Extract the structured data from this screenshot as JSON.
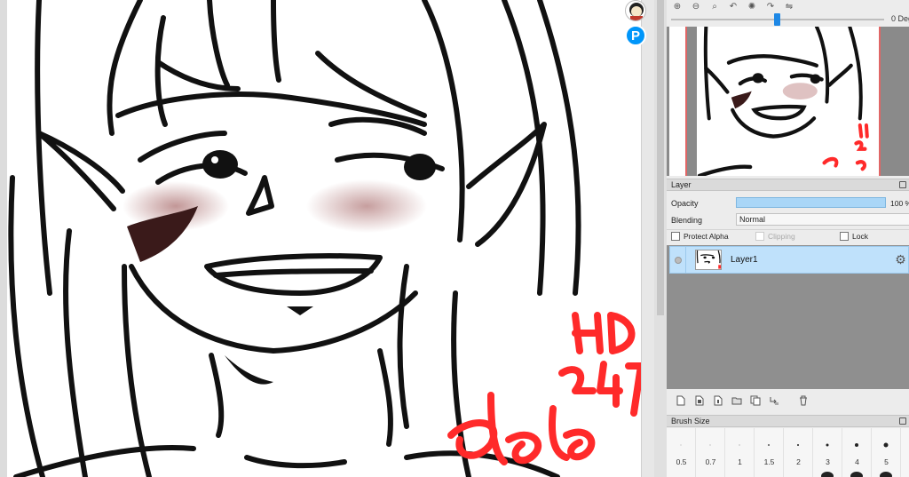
{
  "canvas": {
    "watermark_lines": [
      "HD",
      "247",
      "Laka"
    ],
    "accent_color": "#ff2a2a",
    "blush_color": "#b07070"
  },
  "floating_buttons": {
    "avatar": "user-avatar",
    "pixiv_letter": "P"
  },
  "navigator": {
    "tools": [
      "zoom-in-icon",
      "zoom-out-icon",
      "zoom-fit-icon",
      "rotate-left-icon",
      "rotate-reset-icon",
      "rotate-right-icon",
      "flip-icon"
    ],
    "rotation_label": "0 Deg",
    "rotation_value": 0
  },
  "layer_panel": {
    "title": "Layer",
    "opacity_label": "Opacity",
    "opacity_value": "100 %",
    "opacity_fraction": 1.0,
    "blending_label": "Blending",
    "blending_value": "Normal",
    "protect_alpha_label": "Protect Alpha",
    "clipping_label": "Clipping",
    "lock_label": "Lock",
    "layers": [
      {
        "name": "Layer1",
        "selected": true
      }
    ],
    "toolbar_icons": [
      "new-layer-icon",
      "new-8bit-layer-icon",
      "new-1bit-layer-icon",
      "new-folder-icon",
      "duplicate-layer-icon",
      "merge-down-icon",
      "delete-layer-icon"
    ]
  },
  "brush_size": {
    "title": "Brush Size",
    "sizes": [
      "0.5",
      "0.7",
      "1",
      "1.5",
      "2",
      "3",
      "4",
      "5"
    ],
    "selected_index": 7
  },
  "colors": {
    "selection_blue": "#bfe1fb",
    "slider_blue": "#1e88e5",
    "pixiv_blue": "#0096fa",
    "navigator_border": "#e06666"
  }
}
